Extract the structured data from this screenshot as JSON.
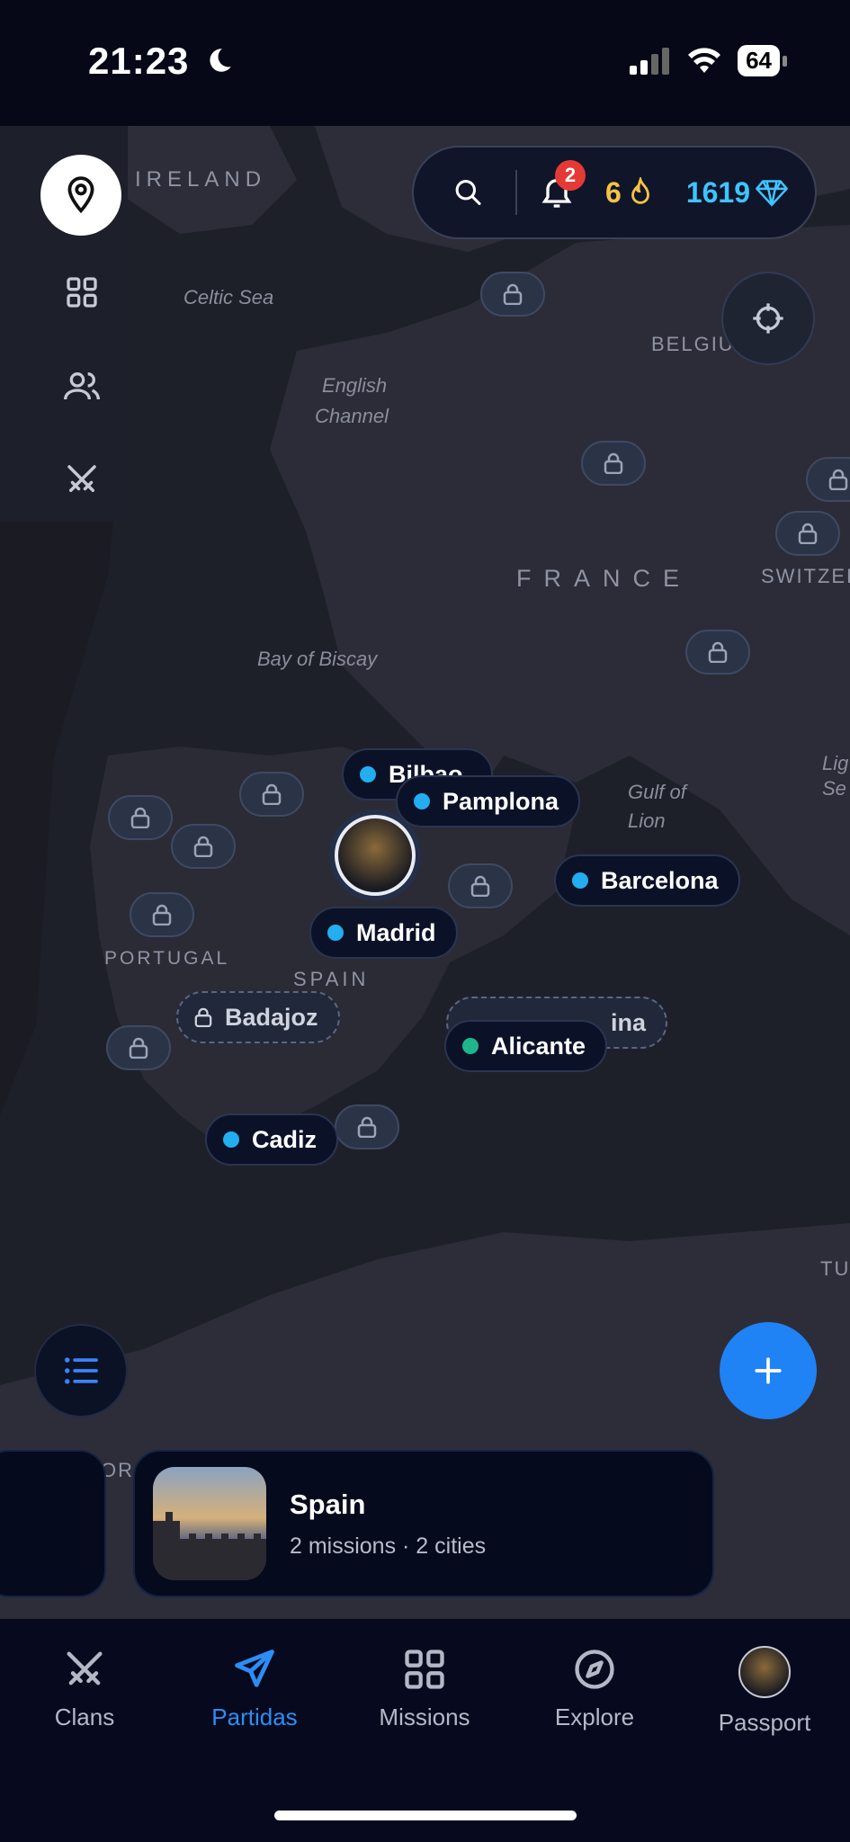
{
  "status_bar": {
    "time": "21:23",
    "battery": "64"
  },
  "top_bar": {
    "notifications_count": "2",
    "streak": "6",
    "gems": "1619"
  },
  "map": {
    "labels": {
      "ireland": "IRELAND",
      "celtic_sea": "Celtic Sea",
      "english_channel_1": "English",
      "english_channel_2": "Channel",
      "belgium": "BELGIU",
      "france": "FRANCE",
      "switzerland": "SWITZER",
      "bay_of_biscay": "Bay of Biscay",
      "gulf_of_lion_1": "Gulf of",
      "gulf_of_lion_2": "Lion",
      "portugal": "PORTUGAL",
      "spain": "SPAIN",
      "lig": "Lig",
      "se": "Se",
      "tu": "TU",
      "or": "OR"
    },
    "cities": {
      "bilbao": "Bilbao",
      "pamplona": "Pamplona",
      "barcelona": "Barcelona",
      "madrid": "Madrid",
      "badajoz": "Badajoz",
      "alicante": "Alicante",
      "murcia_partial": "ina",
      "cadiz": "Cadiz"
    }
  },
  "card": {
    "title": "Spain",
    "subtitle": "2 missions · 2 cities"
  },
  "tabs": [
    {
      "label": "Clans",
      "icon": "swords-icon"
    },
    {
      "label": "Partidas",
      "icon": "plane-icon"
    },
    {
      "label": "Missions",
      "icon": "grid-icon"
    },
    {
      "label": "Explore",
      "icon": "compass-icon"
    },
    {
      "label": "Passport",
      "icon": "avatar"
    }
  ],
  "colors": {
    "accent": "#1f82f5",
    "streak": "#f5c343",
    "gems": "#3ec4ff",
    "city_dot": "#22aef0",
    "alicante_dot": "#1fb58a"
  }
}
